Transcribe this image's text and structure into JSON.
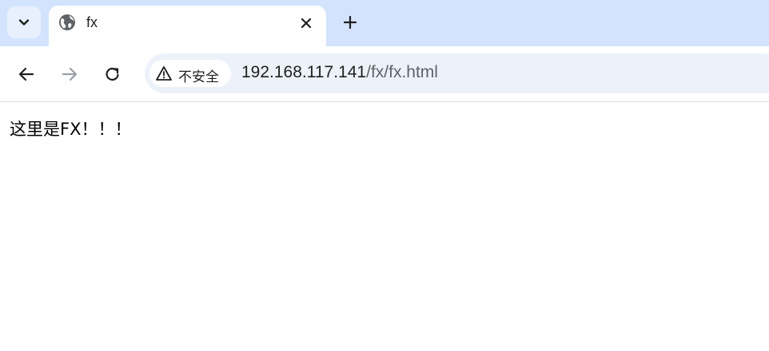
{
  "tab": {
    "title": "fx",
    "favicon": "globe-icon"
  },
  "toolbar": {
    "back_icon": "arrow-left-icon",
    "forward_icon": "arrow-right-icon",
    "reload_icon": "reload-icon"
  },
  "omnibox": {
    "security_label": "不安全",
    "security_icon": "warning-triangle-icon",
    "url_host": "192.168.117.141",
    "url_path": "/fx/fx.html"
  },
  "page": {
    "text": "这里是FX！！！"
  },
  "colors": {
    "tabstrip": "#d3e3fd",
    "omnibox": "#edf2fa",
    "text": "#1f1f1f",
    "muted": "#5f6368"
  }
}
